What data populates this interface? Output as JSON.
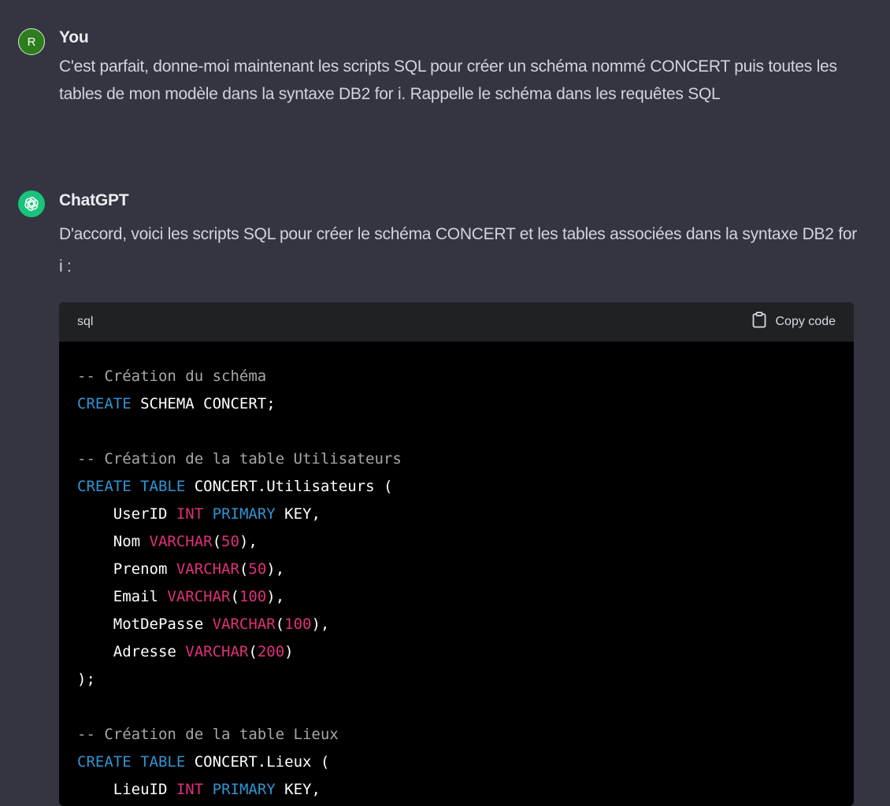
{
  "user_message": {
    "avatar_letter": "R",
    "author": "You",
    "text": "C'est parfait, donne-moi maintenant les scripts SQL pour créer un schéma nommé CONCERT puis toutes les tables de mon modèle dans la syntaxe DB2 for i. Rappelle le schéma dans les requêtes SQL"
  },
  "assistant_message": {
    "author": "ChatGPT",
    "avatar_icon": "openai-logo-icon",
    "text": "D'accord, voici les scripts SQL pour créer le schéma CONCERT et les tables associées dans la syntaxe DB2 for i :"
  },
  "code_block": {
    "language": "sql",
    "copy_label": "Copy code",
    "copy_icon": "clipboard-icon",
    "colors": {
      "comment": "#a7a7a7",
      "keyword": "#2e95d3",
      "type": "#df3079",
      "plain": "#ffffff"
    },
    "lines": [
      [
        {
          "t": "comment",
          "v": "-- Création du schéma"
        }
      ],
      [
        {
          "t": "kw",
          "v": "CREATE"
        },
        {
          "t": "plain",
          "v": " SCHEMA CONCERT;"
        }
      ],
      [],
      [
        {
          "t": "comment",
          "v": "-- Création de la table Utilisateurs"
        }
      ],
      [
        {
          "t": "kw",
          "v": "CREATE"
        },
        {
          "t": "plain",
          "v": " "
        },
        {
          "t": "kw",
          "v": "TABLE"
        },
        {
          "t": "plain",
          "v": " CONCERT.Utilisateurs ("
        }
      ],
      [
        {
          "t": "plain",
          "v": "    UserID "
        },
        {
          "t": "type",
          "v": "INT"
        },
        {
          "t": "plain",
          "v": " "
        },
        {
          "t": "kw",
          "v": "PRIMARY"
        },
        {
          "t": "plain",
          "v": " KEY,"
        }
      ],
      [
        {
          "t": "plain",
          "v": "    Nom "
        },
        {
          "t": "type",
          "v": "VARCHAR"
        },
        {
          "t": "plain",
          "v": "("
        },
        {
          "t": "num",
          "v": "50"
        },
        {
          "t": "plain",
          "v": "),"
        }
      ],
      [
        {
          "t": "plain",
          "v": "    Prenom "
        },
        {
          "t": "type",
          "v": "VARCHAR"
        },
        {
          "t": "plain",
          "v": "("
        },
        {
          "t": "num",
          "v": "50"
        },
        {
          "t": "plain",
          "v": "),"
        }
      ],
      [
        {
          "t": "plain",
          "v": "    Email "
        },
        {
          "t": "type",
          "v": "VARCHAR"
        },
        {
          "t": "plain",
          "v": "("
        },
        {
          "t": "num",
          "v": "100"
        },
        {
          "t": "plain",
          "v": "),"
        }
      ],
      [
        {
          "t": "plain",
          "v": "    MotDePasse "
        },
        {
          "t": "type",
          "v": "VARCHAR"
        },
        {
          "t": "plain",
          "v": "("
        },
        {
          "t": "num",
          "v": "100"
        },
        {
          "t": "plain",
          "v": "),"
        }
      ],
      [
        {
          "t": "plain",
          "v": "    Adresse "
        },
        {
          "t": "type",
          "v": "VARCHAR"
        },
        {
          "t": "plain",
          "v": "("
        },
        {
          "t": "num",
          "v": "200"
        },
        {
          "t": "plain",
          "v": ")"
        }
      ],
      [
        {
          "t": "plain",
          "v": ");"
        }
      ],
      [],
      [
        {
          "t": "comment",
          "v": "-- Création de la table Lieux"
        }
      ],
      [
        {
          "t": "kw",
          "v": "CREATE"
        },
        {
          "t": "plain",
          "v": " "
        },
        {
          "t": "kw",
          "v": "TABLE"
        },
        {
          "t": "plain",
          "v": " CONCERT.Lieux ("
        }
      ],
      [
        {
          "t": "plain",
          "v": "    LieuID "
        },
        {
          "t": "type",
          "v": "INT"
        },
        {
          "t": "plain",
          "v": " "
        },
        {
          "t": "kw",
          "v": "PRIMARY"
        },
        {
          "t": "plain",
          "v": " KEY,"
        }
      ]
    ]
  }
}
